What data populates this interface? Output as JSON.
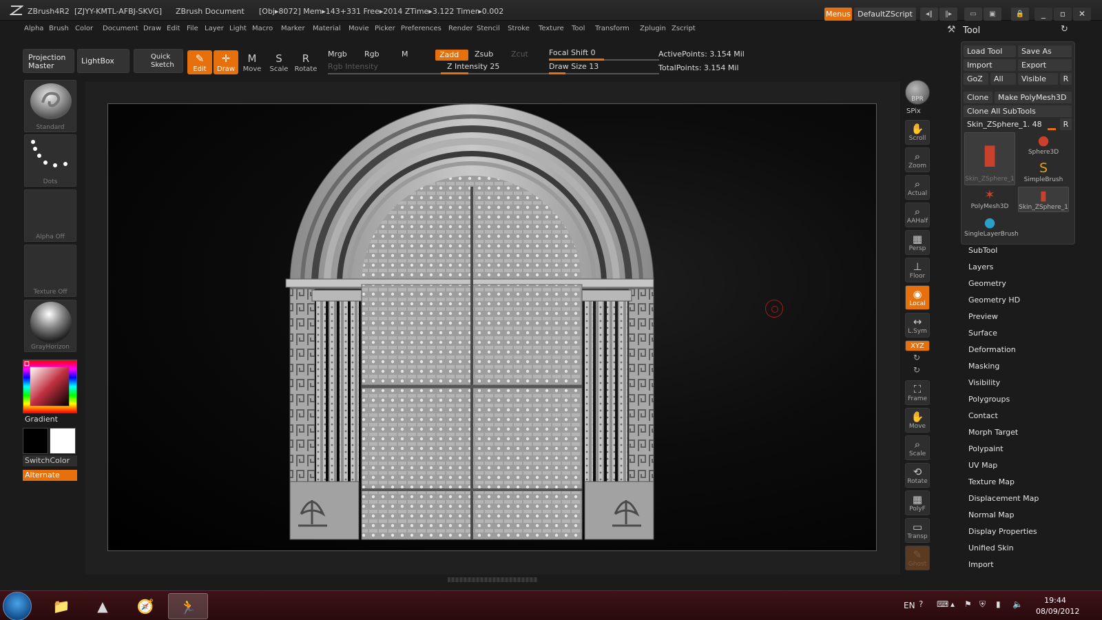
{
  "titlebar": {
    "app": "ZBrush4R2",
    "serial": "[ZJYY-KMTL-AFBJ-SKVG]",
    "document": "ZBrush Document",
    "stats": "[Obj▸8072] Mem▸143+331  Free▸2014  ZTime▸3.122  Timer▸0.002",
    "menus_label": "Menus",
    "zscript_label": "DefaultZScript"
  },
  "menubar": [
    "Alpha",
    "Brush",
    "Color",
    "Document",
    "Draw",
    "Edit",
    "File",
    "Layer",
    "Light",
    "Macro",
    "Marker",
    "Material",
    "Movie",
    "Picker",
    "Preferences",
    "Render",
    "Stencil",
    "Stroke",
    "Texture",
    "Tool",
    "Transform",
    "Zplugin",
    "Zscript"
  ],
  "shelf": {
    "projection_master": "Projection Master",
    "lightbox": "LightBox",
    "quick_sketch": "Quick Sketch",
    "edit": "Edit",
    "draw": "Draw",
    "move": "Move",
    "scale": "Scale",
    "rotate": "Rotate",
    "mrgb": "Mrgb",
    "rgb": "Rgb",
    "m": "M",
    "rgb_intensity": "Rgb Intensity",
    "zadd": "Zadd",
    "zsub": "Zsub",
    "zcut": "Zcut",
    "z_intensity": "Z Intensity 25",
    "focal_shift": "Focal Shift 0",
    "draw_size": "Draw Size 13",
    "active_points": "ActivePoints: 3.154 Mil",
    "total_points": "TotalPoints: 3.154 Mil",
    "z_intensity_level": 0.25,
    "focal_shift_level": 0.5,
    "draw_size_level": 0.15
  },
  "left": {
    "brush": "Standard",
    "stroke": "Dots",
    "alpha": "Alpha  Off",
    "texture": "Texture  Off",
    "material": "GrayHorizon",
    "gradient": "Gradient",
    "switchcolor": "SwitchColor",
    "alternate": "Alternate"
  },
  "right": {
    "bpr": "BPR",
    "spix": "SPix",
    "buttons": [
      "Scroll",
      "Zoom",
      "Actual",
      "AAHalf",
      "Persp",
      "Floor",
      "Local",
      "L.Sym",
      "XYZ",
      "Frame",
      "Move",
      "Scale",
      "Rotate",
      "PolyF",
      "Transp",
      "Ghost"
    ]
  },
  "tool": {
    "title": "Tool",
    "load_tool": "Load Tool",
    "save_as": "Save As",
    "import": "Import",
    "export": "Export",
    "goz": "GoZ",
    "all": "All",
    "visible": "Visible",
    "r": "R",
    "clone": "Clone",
    "make_polymesh": "Make PolyMesh3D",
    "clone_all": "Clone All SubTools",
    "current": "Skin_ZSphere_1. 48",
    "thumbs": [
      "Skin_ZSphere_1",
      "Sphere3D",
      "SimpleBrush",
      "PolyMesh3D",
      "Skin_ZSphere_1",
      "SingleLayerBrush"
    ],
    "subpanels": [
      "SubTool",
      "Layers",
      "Geometry",
      "Geometry HD",
      "Preview",
      "Surface",
      "Deformation",
      "Masking",
      "Visibility",
      "Polygroups",
      "Contact",
      "Morph Target",
      "Polypaint",
      "UV Map",
      "Texture Map",
      "Displacement Map",
      "Normal Map",
      "Display Properties",
      "Unified Skin",
      "Import"
    ]
  },
  "taskbar": {
    "lang": "EN",
    "time": "19:44",
    "date": "08/09/2012"
  },
  "colors": {
    "accent": "#e6700c",
    "panel": "#2b2b2b",
    "taskbar": "#3e1317"
  }
}
